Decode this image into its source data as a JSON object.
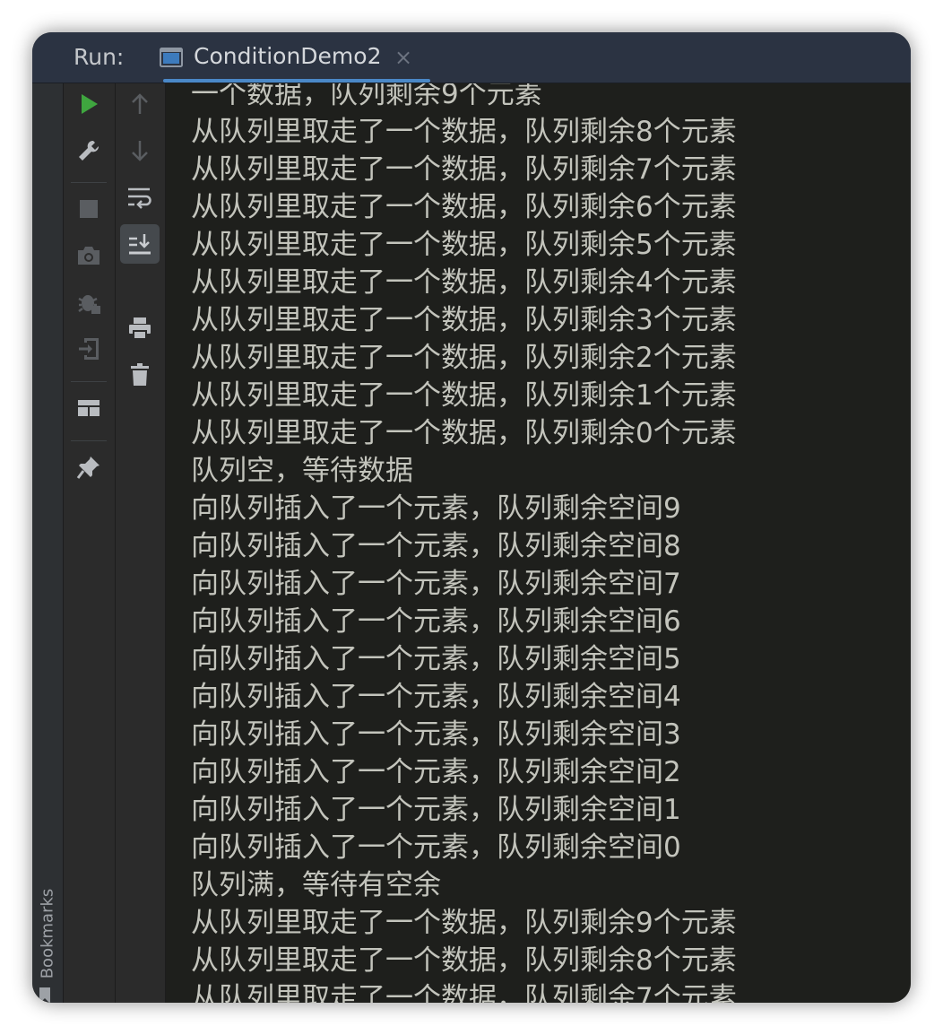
{
  "topbar": {
    "run_label": "Run:",
    "tab_title": "ConditionDemo2",
    "tab_close": "×"
  },
  "sidebar": {
    "bookmarks_label": "Bookmarks"
  },
  "colors": {
    "accent": "#4a88c7",
    "run_green": "#3fa63f",
    "console_text": "#c3c4bc",
    "console_bg": "#1e1f1c"
  },
  "toolbar_left": [
    {
      "icon": "run-icon",
      "enabled": true
    },
    {
      "icon": "wrench-icon",
      "enabled": true
    },
    {
      "icon": "stop-icon",
      "enabled": false
    },
    {
      "icon": "camera-icon",
      "enabled": false
    },
    {
      "icon": "debug-icon",
      "enabled": false
    },
    {
      "icon": "exit-icon",
      "enabled": false
    },
    {
      "icon": "layout-icon",
      "enabled": true
    },
    {
      "icon": "pin-icon",
      "enabled": true
    }
  ],
  "toolbar_right": [
    {
      "icon": "arrow-up-icon",
      "enabled": false
    },
    {
      "icon": "arrow-down-icon",
      "enabled": false
    },
    {
      "icon": "soft-wrap-icon",
      "enabled": true
    },
    {
      "icon": "scroll-to-end-icon",
      "enabled": true,
      "active": true
    },
    {
      "icon": "print-icon",
      "enabled": true
    },
    {
      "icon": "trash-icon",
      "enabled": true
    }
  ],
  "console": {
    "lines": [
      "一个数据，队列剩余9个元素",
      "从队列里取走了一个数据，队列剩余8个元素",
      "从队列里取走了一个数据，队列剩余7个元素",
      "从队列里取走了一个数据，队列剩余6个元素",
      "从队列里取走了一个数据，队列剩余5个元素",
      "从队列里取走了一个数据，队列剩余4个元素",
      "从队列里取走了一个数据，队列剩余3个元素",
      "从队列里取走了一个数据，队列剩余2个元素",
      "从队列里取走了一个数据，队列剩余1个元素",
      "从队列里取走了一个数据，队列剩余0个元素",
      "队列空，等待数据",
      "向队列插入了一个元素，队列剩余空间9",
      "向队列插入了一个元素，队列剩余空间8",
      "向队列插入了一个元素，队列剩余空间7",
      "向队列插入了一个元素，队列剩余空间6",
      "向队列插入了一个元素，队列剩余空间5",
      "向队列插入了一个元素，队列剩余空间4",
      "向队列插入了一个元素，队列剩余空间3",
      "向队列插入了一个元素，队列剩余空间2",
      "向队列插入了一个元素，队列剩余空间1",
      "向队列插入了一个元素，队列剩余空间0",
      "队列满，等待有空余",
      "从队列里取走了一个数据，队列剩余9个元素",
      "从队列里取走了一个数据，队列剩余8个元素",
      "从队列里取走了一个数据，队列剩余7个元素"
    ]
  }
}
